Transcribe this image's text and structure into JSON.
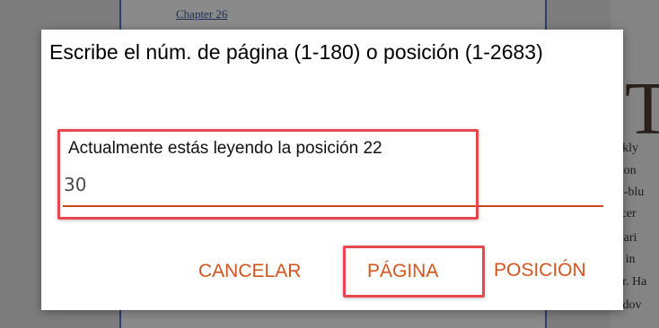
{
  "background": {
    "chapter_link": "Chapter 26",
    "right_page_fragments": [
      "ickly",
      "ason",
      "ry-blu",
      "ficer",
      "Stari",
      "le in",
      "ler. Ha",
      "n dov"
    ],
    "dropcap": "T"
  },
  "dialog": {
    "title": "Escribe el núm. de página (1-180) o posición (1-2683)",
    "input": {
      "hint": "Actualmente estás leyendo la posición 22",
      "value": "30"
    },
    "buttons": {
      "cancel": "CANCELAR",
      "page": "PÁGINA",
      "position": "POSICIÓN"
    }
  },
  "colors": {
    "accent": "#d2541f",
    "underline": "#c84a1a",
    "highlight": "#e8474f",
    "overlay": "#7d7d7d"
  }
}
